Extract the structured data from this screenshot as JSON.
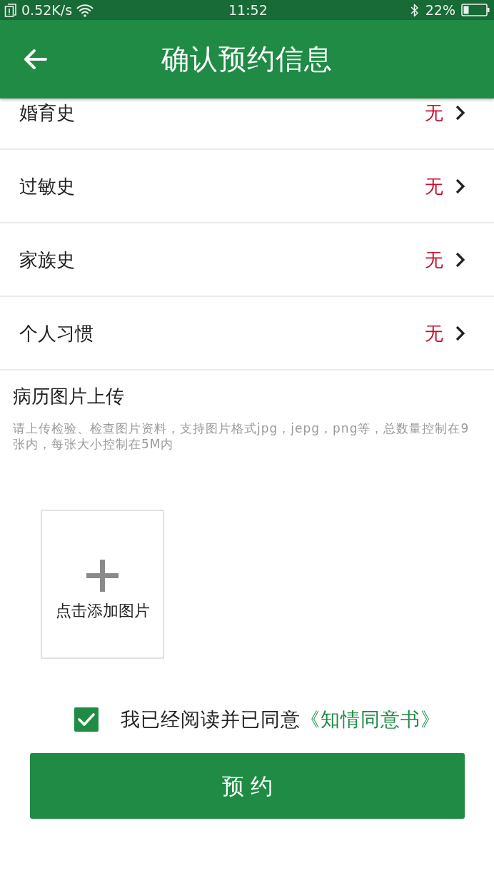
{
  "status_bar": {
    "network_speed": "0.52K/s",
    "time": "11:52",
    "battery_percent": "22%"
  },
  "header": {
    "title": "确认预约信息"
  },
  "history_rows": [
    {
      "label": "婚育史",
      "value": "无"
    },
    {
      "label": "过敏史",
      "value": "无"
    },
    {
      "label": "家族史",
      "value": "无"
    },
    {
      "label": "个人习惯",
      "value": "无"
    }
  ],
  "upload": {
    "title": "病历图片上传",
    "description": "请上传检验、检查图片资料，支持图片格式jpg，jepg，png等，总数量控制在9张内，每张大小控制在5M内",
    "add_label": "点击添加图片"
  },
  "consent": {
    "checked": true,
    "text": "我已经阅读并已同意",
    "link": "《知情同意书》"
  },
  "submit_button": {
    "label": "预 约"
  }
}
